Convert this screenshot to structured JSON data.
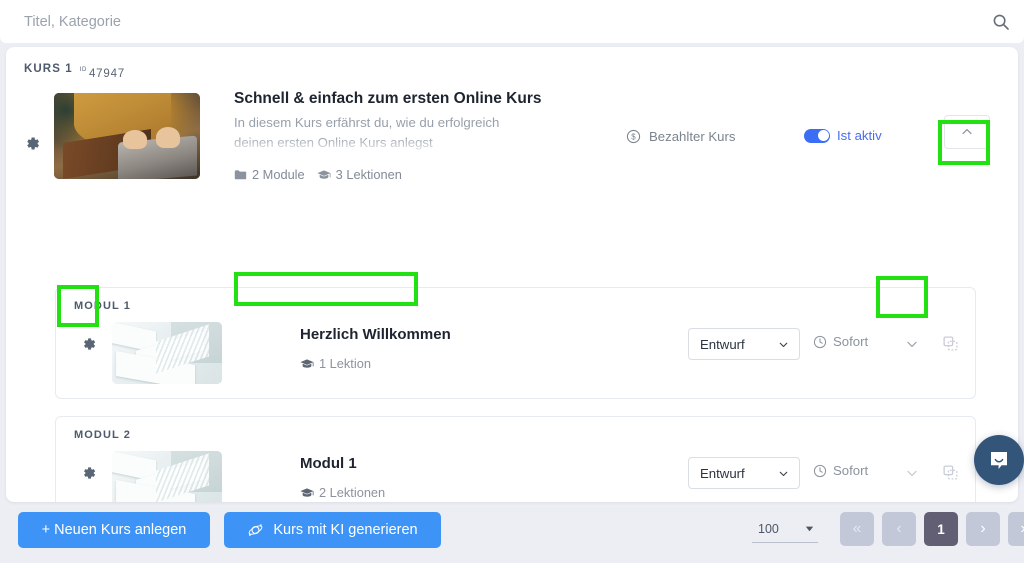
{
  "search": {
    "placeholder": "Titel, Kategorie",
    "value": "",
    "icon": "search-icon"
  },
  "course": {
    "label": "KURS 1",
    "id_prefix": "ID",
    "id": "47947",
    "title": "Schnell & einfach zum ersten Online Kurs",
    "description_line1": "In diesem Kurs erfährst du, wie du erfolgreich",
    "description_line2": "deinen ersten Online Kurs anlegst",
    "modules_count": "2 Module",
    "lessons_count": "3 Lektionen",
    "paid_badge": "Bezahlter Kurs",
    "paid_icon": "dollar-circle-icon",
    "active_label": "Ist aktiv",
    "active_state": true,
    "collapse_icon": "chevron-up-icon",
    "gear_icon": "gear-icon",
    "thumbnail_alt": "person-typing-laptop-photo"
  },
  "modules": [
    {
      "label": "MODUL 1",
      "title": "Herzlich Willkommen",
      "lessons": "1 Lektion",
      "lessons_icon": "graduation-cap-icon",
      "status": "Entwurf",
      "status_chevron": "chevron-down-icon",
      "time": "Sofort",
      "time_icon": "clock-icon",
      "expand_icon": "chevron-down-icon",
      "copy_icon": "duplicate-icon",
      "gear_icon": "gear-icon",
      "thumbnail_alt": "white-stairs-architecture-photo"
    },
    {
      "label": "MODUL 2",
      "title": "Modul 1",
      "lessons": "2 Lektionen",
      "lessons_icon": "graduation-cap-icon",
      "status": "Entwurf",
      "status_chevron": "chevron-down-icon",
      "time": "Sofort",
      "time_icon": "clock-icon",
      "expand_icon": "chevron-down-icon",
      "copy_icon": "duplicate-icon",
      "gear_icon": "gear-icon",
      "thumbnail_alt": "white-stairs-architecture-photo"
    }
  ],
  "footer": {
    "new_course_label": "+ Neuen Kurs anlegen",
    "ai_course_label": "Kurs mit KI generieren",
    "ai_icon": "ai-sparkle-icon"
  },
  "pagination": {
    "page_size": "100",
    "page_size_chevron": "caret-down-icon",
    "first_label": "«",
    "prev_label": "‹",
    "current_page": "1",
    "next_label": "›",
    "last_label": "»"
  },
  "support": {
    "launcher_icon": "chat-bubble-icon"
  },
  "highlights": {
    "collapse": "course-collapse-button",
    "module_gear": "module-1-settings-button",
    "module_title": "module-1-title",
    "module_expand": "module-1-expand-button"
  },
  "colors": {
    "page_bg": "#eceef4",
    "accent_blue": "#3d94f6",
    "toggle_blue": "#3b6ef5",
    "toggle_text": "#4a6cf0",
    "highlight_green": "#22e012",
    "pager_grey": "#c3c8d8",
    "pager_current": "#625e73",
    "intercom_navy": "#34557a"
  }
}
